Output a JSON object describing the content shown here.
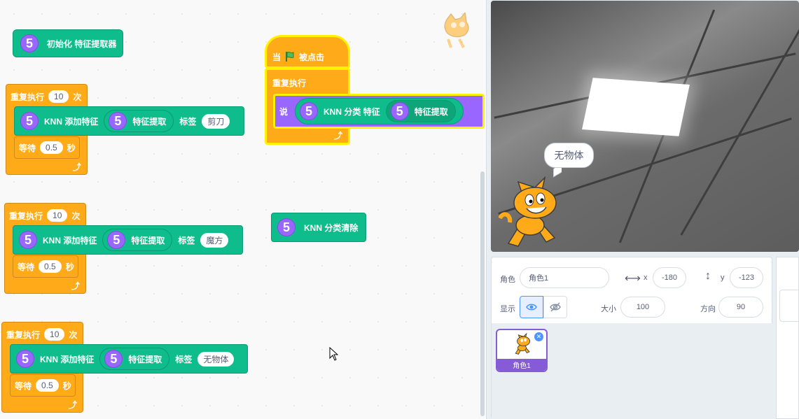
{
  "code": {
    "init_block": {
      "badge": "5",
      "label": "初始化 特征提取器"
    },
    "repeat_blocks": [
      {
        "repeat_label": "重复执行",
        "count": "10",
        "times": "次",
        "badge": "5",
        "add_label": "KNN 添加特征",
        "feature_label": "特征提取",
        "tag_label": "标签",
        "tag_value": "剪刀",
        "wait_label": "等待",
        "wait_value": "0.5",
        "sec_label": "秒"
      },
      {
        "repeat_label": "重复执行",
        "count": "10",
        "times": "次",
        "badge": "5",
        "add_label": "KNN 添加特征",
        "feature_label": "特征提取",
        "tag_label": "标签",
        "tag_value": "魔方",
        "wait_label": "等待",
        "wait_value": "0.5",
        "sec_label": "秒"
      },
      {
        "repeat_label": "重复执行",
        "count": "10",
        "times": "次",
        "badge": "5",
        "add_label": "KNN 添加特征",
        "feature_label": "特征提取",
        "tag_label": "标签",
        "tag_value": "无物体",
        "wait_label": "等待",
        "wait_value": "0.5",
        "sec_label": "秒"
      }
    ],
    "flag_script": {
      "when": "当",
      "clicked": "被点击",
      "forever": "重复执行",
      "say": "说",
      "classify_label": "KNN 分类 特征",
      "feature_label": "特征提取",
      "badge": "5"
    },
    "clear_block": {
      "badge": "5",
      "label": "KNN 分类清除"
    }
  },
  "stage": {
    "speech": "无物体"
  },
  "sprite_info": {
    "sprite_label": "角色",
    "sprite_name": "角色1",
    "x_label": "x",
    "x_value": "-180",
    "y_label": "y",
    "y_value": "-123",
    "show_label": "显示",
    "size_label": "大小",
    "size_value": "100",
    "direction_label": "方向",
    "direction_value": "90"
  },
  "sprite_list": [
    {
      "name": "角色1"
    }
  ],
  "colors": {
    "motion_green": "#0fbd8c",
    "control_orange": "#ffab19",
    "looks_purple": "#9966ff",
    "selection_purple": "#855cd6"
  },
  "icons": [
    "cat-head-icon",
    "green-flag-icon",
    "loop-arrow-icon",
    "eye-icon",
    "eye-off-icon",
    "delete-icon",
    "cursor-icon",
    "horizontal-arrows-icon",
    "vertical-arrows-icon"
  ]
}
